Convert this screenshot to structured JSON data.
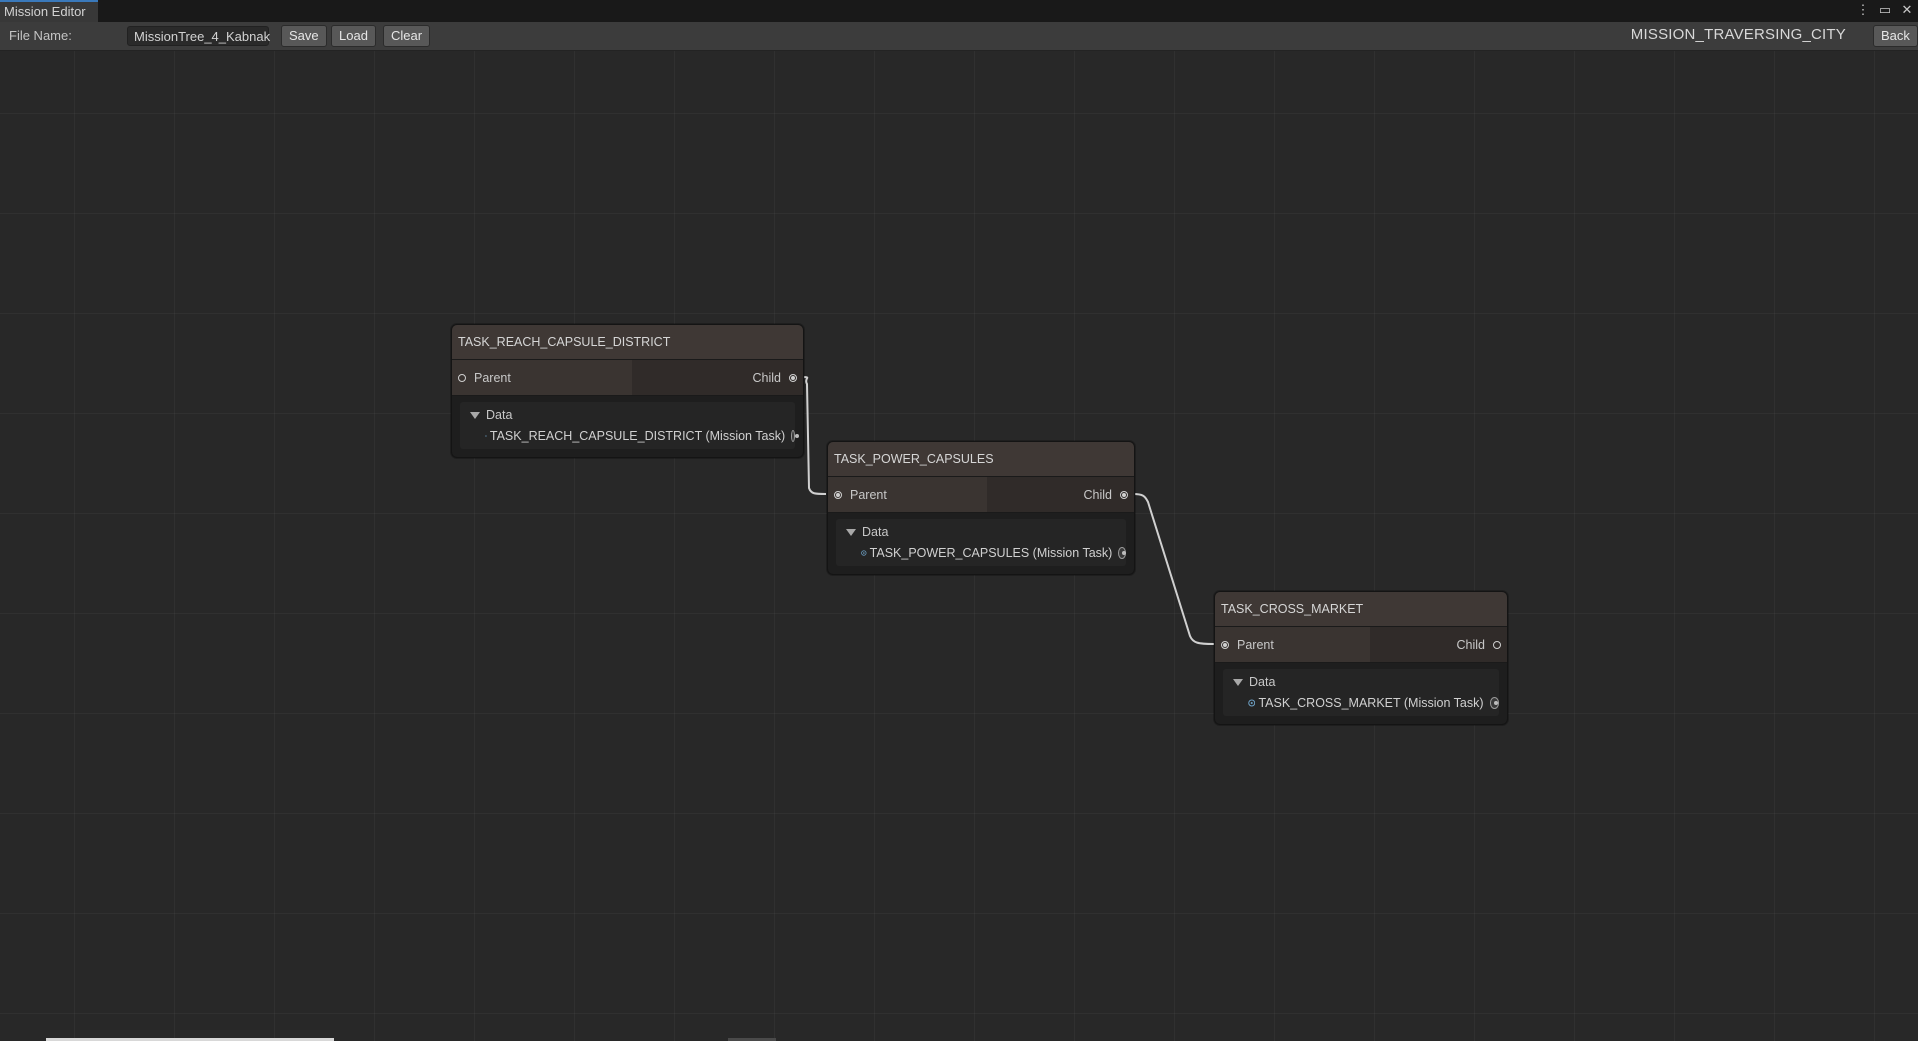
{
  "window": {
    "tab_title": "Mission Editor",
    "controls": [
      "more-icon",
      "maximize-icon",
      "close-icon"
    ]
  },
  "toolbar": {
    "file_label": "File Name:",
    "file_value": "MissionTree_4_Kabnak",
    "save_label": "Save",
    "load_label": "Load",
    "clear_label": "Clear",
    "mission_title": "MISSION_TRAVERSING_CITY",
    "back_label": "Back"
  },
  "nodes": [
    {
      "title": "TASK_REACH_CAPSULE_DISTRICT",
      "parent_label": "Parent",
      "child_label": "Child",
      "data_label": "Data",
      "data_value": "TASK_REACH_CAPSULE_DISTRICT (Mission Task)",
      "parent_connected": false,
      "child_connected": true
    },
    {
      "title": "TASK_POWER_CAPSULES",
      "parent_label": "Parent",
      "child_label": "Child",
      "data_label": "Data",
      "data_value": "TASK_POWER_CAPSULES (Mission Task)",
      "parent_connected": true,
      "child_connected": true
    },
    {
      "title": "TASK_CROSS_MARKET",
      "parent_label": "Parent",
      "child_label": "Child",
      "data_label": "Data",
      "data_value": "TASK_CROSS_MARKET (Mission Task)",
      "parent_connected": true,
      "child_connected": false
    }
  ],
  "colors": {
    "background": "#282828",
    "node_header": "#3f3835",
    "edge": "#d0d0d0",
    "tab_accent": "#3a79bb"
  }
}
